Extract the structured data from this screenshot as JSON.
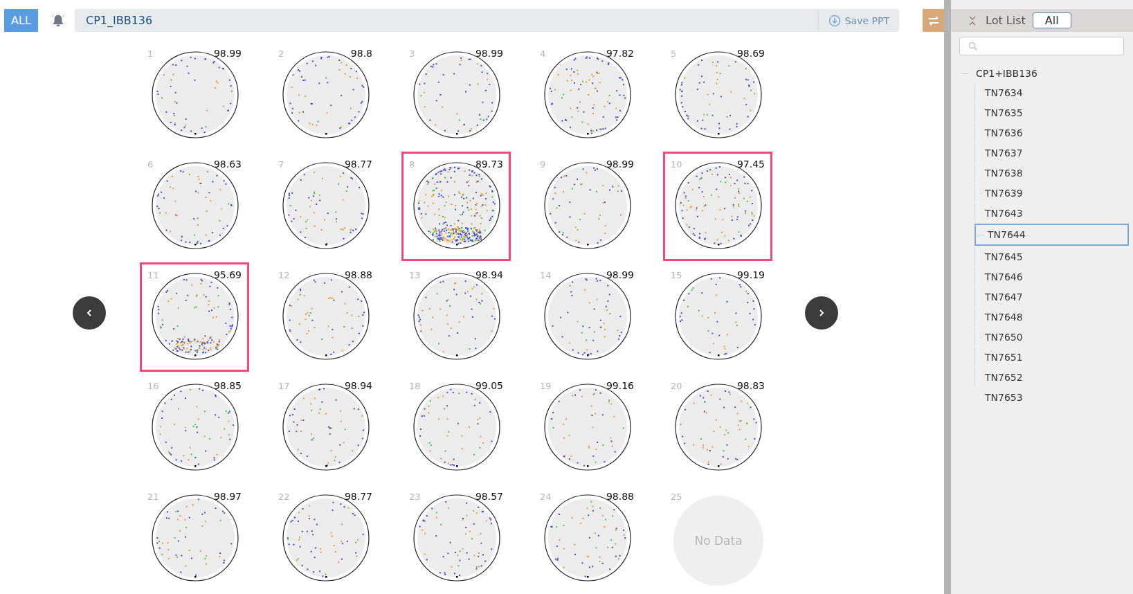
{
  "toolbar": {
    "all_button": "ALL",
    "lot_title": "CP1_IBB136",
    "save_button": "Save PPT"
  },
  "wafers": [
    {
      "index": "1",
      "yield": "98.99",
      "flagged": false
    },
    {
      "index": "2",
      "yield": "98.8",
      "flagged": false
    },
    {
      "index": "3",
      "yield": "98.99",
      "flagged": false
    },
    {
      "index": "4",
      "yield": "97.82",
      "flagged": false
    },
    {
      "index": "5",
      "yield": "98.69",
      "flagged": false
    },
    {
      "index": "6",
      "yield": "98.63",
      "flagged": false
    },
    {
      "index": "7",
      "yield": "98.77",
      "flagged": false
    },
    {
      "index": "8",
      "yield": "89.73",
      "flagged": true
    },
    {
      "index": "9",
      "yield": "98.99",
      "flagged": false
    },
    {
      "index": "10",
      "yield": "97.45",
      "flagged": true
    },
    {
      "index": "11",
      "yield": "95.69",
      "flagged": true
    },
    {
      "index": "12",
      "yield": "98.88",
      "flagged": false
    },
    {
      "index": "13",
      "yield": "98.94",
      "flagged": false
    },
    {
      "index": "14",
      "yield": "98.99",
      "flagged": false
    },
    {
      "index": "15",
      "yield": "99.19",
      "flagged": false
    },
    {
      "index": "16",
      "yield": "98.85",
      "flagged": false
    },
    {
      "index": "17",
      "yield": "98.94",
      "flagged": false
    },
    {
      "index": "18",
      "yield": "99.05",
      "flagged": false
    },
    {
      "index": "19",
      "yield": "99.16",
      "flagged": false
    },
    {
      "index": "20",
      "yield": "98.83",
      "flagged": false
    },
    {
      "index": "21",
      "yield": "98.97",
      "flagged": false
    },
    {
      "index": "22",
      "yield": "98.77",
      "flagged": false
    },
    {
      "index": "23",
      "yield": "98.57",
      "flagged": false
    },
    {
      "index": "24",
      "yield": "98.88",
      "flagged": false
    },
    {
      "index": "25",
      "no_data": "No Data",
      "flagged": false
    }
  ],
  "lot_panel": {
    "title": "Lot List",
    "filter_button": "All",
    "tree": [
      {
        "label": "CP1+IBB136",
        "expanded": true,
        "children": [
          {
            "label": "TN7634",
            "selected": false
          },
          {
            "label": "TN7635",
            "selected": false
          },
          {
            "label": "TN7636",
            "selected": false
          },
          {
            "label": "TN7637",
            "selected": false
          },
          {
            "label": "TN7638",
            "selected": false
          },
          {
            "label": "TN7639",
            "selected": false
          },
          {
            "label": "TN7643",
            "selected": false
          },
          {
            "label": "TN7644",
            "selected": true
          },
          {
            "label": "TN7645",
            "selected": false
          },
          {
            "label": "TN7646",
            "selected": false
          },
          {
            "label": "TN7647",
            "selected": false
          },
          {
            "label": "TN7648",
            "selected": false
          },
          {
            "label": "TN7650",
            "selected": false
          },
          {
            "label": "TN7651",
            "selected": false
          },
          {
            "label": "TN7652",
            "selected": false
          },
          {
            "label": "TN7653",
            "selected": false
          }
        ]
      }
    ]
  }
}
